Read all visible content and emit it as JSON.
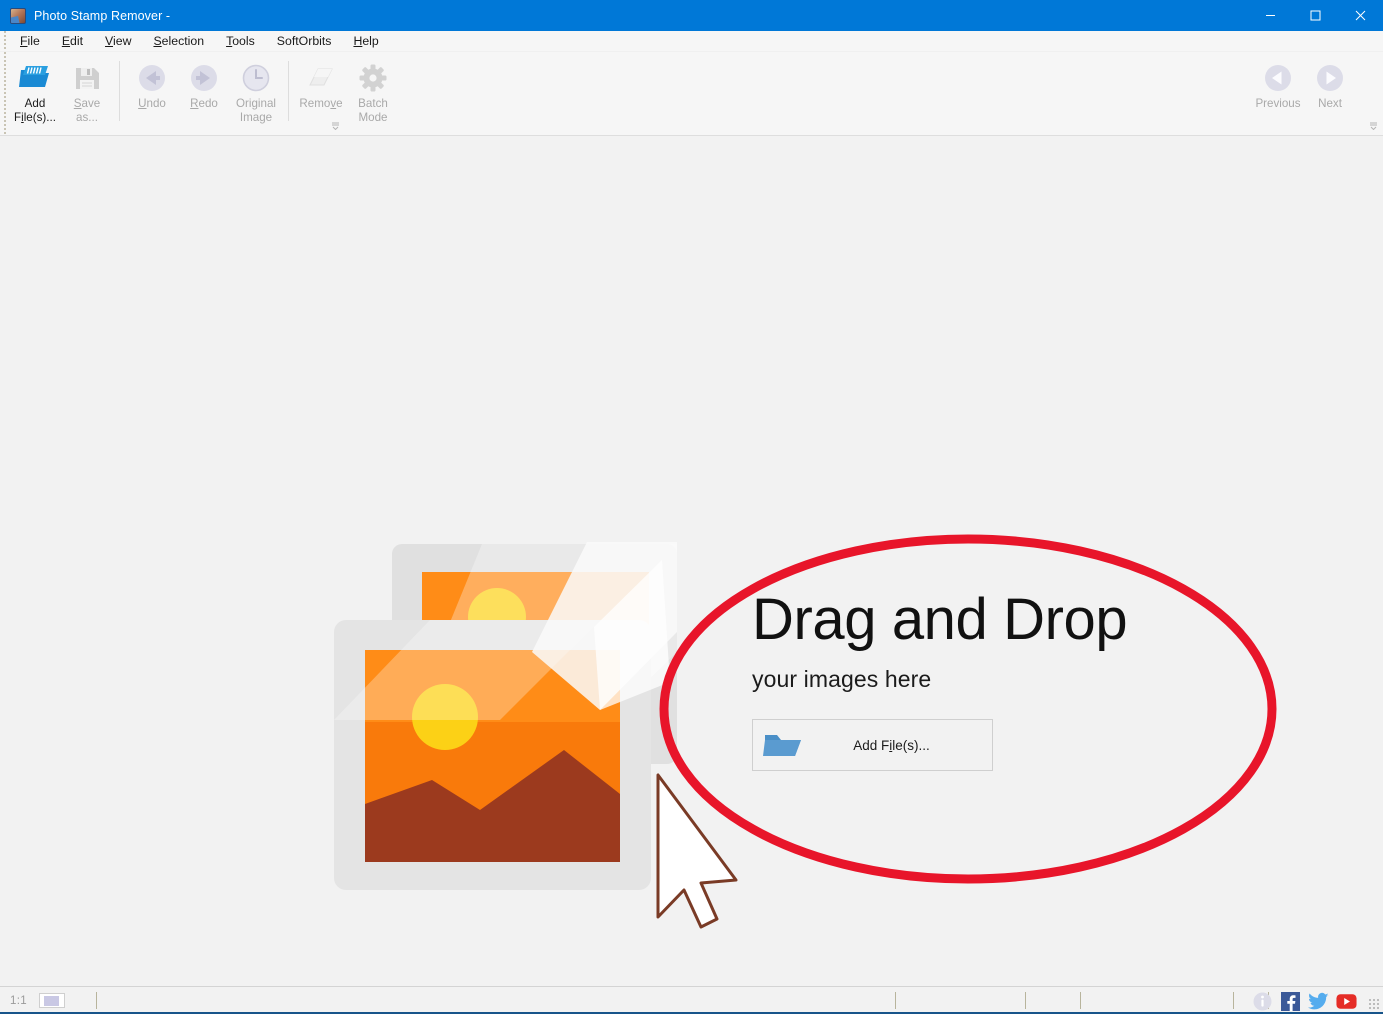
{
  "window": {
    "title": "Photo Stamp Remover - ",
    "icon": "app-photo-icon",
    "minimize_label": "Minimize",
    "maximize_label": "Maximize",
    "close_label": "Close",
    "titlebar_color": "#0078d7"
  },
  "menubar": {
    "items": [
      {
        "label": "File",
        "mnemonic": "F"
      },
      {
        "label": "Edit",
        "mnemonic": "E"
      },
      {
        "label": "View",
        "mnemonic": "V"
      },
      {
        "label": "Selection",
        "mnemonic": "S"
      },
      {
        "label": "Tools",
        "mnemonic": "T"
      },
      {
        "label": "SoftOrbits",
        "mnemonic": ""
      },
      {
        "label": "Help",
        "mnemonic": "H"
      }
    ]
  },
  "toolbar": {
    "buttons": [
      {
        "label": "Add\nFile(s)...",
        "icon": "open-folder-icon",
        "enabled": true
      },
      {
        "label": "Save\nas...",
        "icon": "floppy-save-icon",
        "enabled": false
      },
      {
        "label": "Undo",
        "icon": "undo-arrow-icon",
        "enabled": false
      },
      {
        "label": "Redo",
        "icon": "redo-arrow-icon",
        "enabled": false
      },
      {
        "label": "Original\nImage",
        "icon": "clock-history-icon",
        "enabled": false
      },
      {
        "label": "Remove",
        "icon": "eraser-icon",
        "enabled": false
      },
      {
        "label": "Batch\nMode",
        "icon": "gear-icon",
        "enabled": false
      }
    ],
    "nav": [
      {
        "label": "Previous",
        "icon": "arrow-left-circle-icon",
        "enabled": false
      },
      {
        "label": "Next",
        "icon": "arrow-right-circle-icon",
        "enabled": false
      }
    ],
    "overflow_label": "More commands"
  },
  "canvas": {
    "illustration": "two-photos-with-cursor-illustration",
    "dnd": {
      "title": "Drag and Drop",
      "subtitle": "your images here",
      "button_label": "Add File(s)...",
      "button_icon": "open-folder-icon"
    },
    "annotation": {
      "shape": "red-ellipse-highlight",
      "color": "#e8152a"
    }
  },
  "statusbar": {
    "zoom": "1:1",
    "thumbnail_icon": "navigator-thumbnail-icon",
    "panels": [
      "",
      "",
      "",
      ""
    ],
    "social": [
      {
        "name": "info-icon",
        "label": "Info"
      },
      {
        "name": "facebook-icon",
        "label": "Facebook"
      },
      {
        "name": "twitter-icon",
        "label": "Twitter"
      },
      {
        "name": "youtube-icon",
        "label": "YouTube"
      }
    ]
  }
}
